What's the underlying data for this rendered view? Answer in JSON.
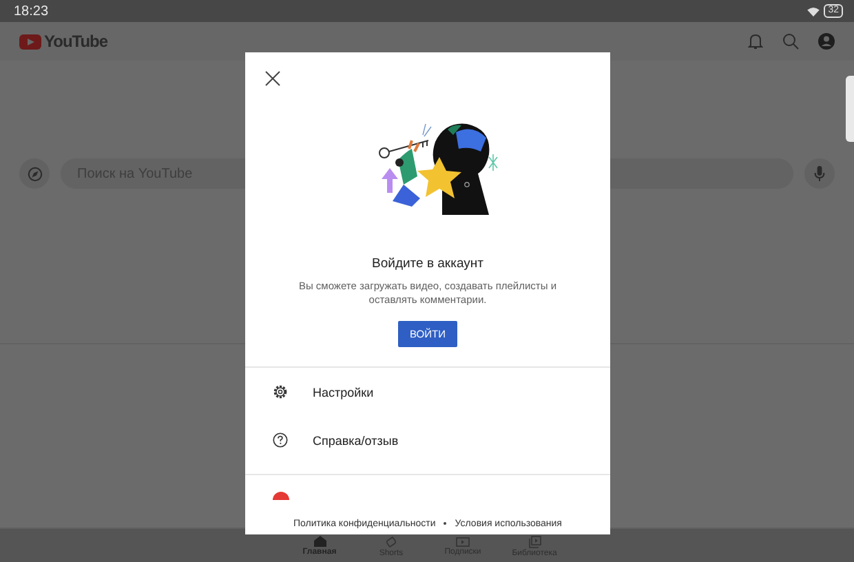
{
  "status_bar": {
    "time": "18:23",
    "battery": "32"
  },
  "app_bar": {
    "logo": "YouTube"
  },
  "search": {
    "placeholder": "Поиск на YouTube"
  },
  "dialog": {
    "title": "Войдите в аккаунт",
    "text": "Вы сможете загружать видео, создавать плейлисты и оставлять комментарии.",
    "sign_in_button": "ВОЙТИ",
    "menu": [
      {
        "kind": "settings",
        "label": "Настройки"
      },
      {
        "kind": "help",
        "label": "Справка/отзыв"
      },
      {
        "kind": "music"
      }
    ],
    "footer_links": [
      "Политика конфиденциальности",
      "Условия использования"
    ]
  },
  "bottom_nav": [
    {
      "kind": "home",
      "label": "Главная",
      "selected": true
    },
    {
      "kind": "shorts",
      "label": "Shorts",
      "selected": false
    },
    {
      "kind": "subs",
      "label": "Подписки",
      "selected": false
    },
    {
      "kind": "library",
      "label": "Библиотека",
      "selected": false
    }
  ]
}
